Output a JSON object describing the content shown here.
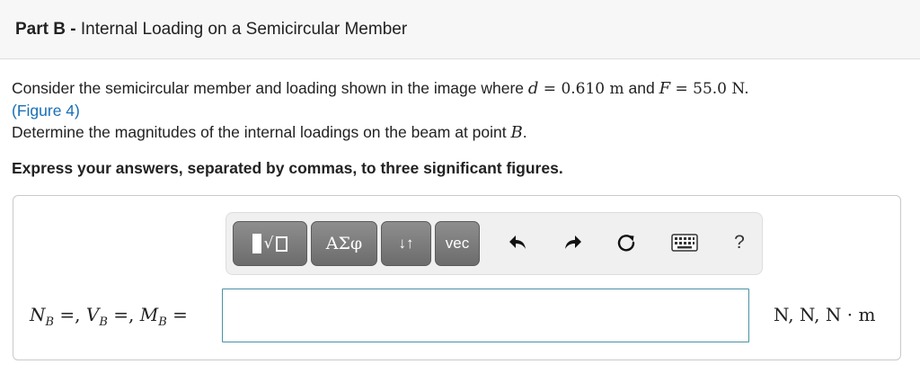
{
  "header": {
    "part_label": "Part B",
    "separator": " - ",
    "title": "Internal Loading on a Semicircular Member"
  },
  "problem": {
    "intro": "Consider the semicircular member and loading shown in the image where ",
    "d_symbol": "d",
    "d_value": " = 0.610 m",
    "and": " and ",
    "f_symbol": "F",
    "f_value": " = 55.0 N.",
    "figure_link": "(Figure 4)",
    "determine": "Determine the magnitudes of the internal loadings on the beam at point ",
    "point_symbol": "B",
    "period": "."
  },
  "instruction": "Express your answers, separated by commas, to three significant figures.",
  "toolbar": {
    "templates_icon": "templates-sqrt-icon",
    "templates_sqrt": "√",
    "greek_label": "ΑΣφ",
    "arrows_label": "↓↑",
    "vec_label": "vec",
    "undo_icon": "undo-icon",
    "redo_icon": "redo-icon",
    "reset_icon": "reset-icon",
    "keyboard_icon": "keyboard-icon",
    "help_label": "?"
  },
  "answer": {
    "n_symbol": "N",
    "v_symbol": "V",
    "m_symbol": "M",
    "subscript": "B",
    "eq": " =, ",
    "eq_last": " =",
    "value": "",
    "units": "N, N, N · m"
  },
  "colors": {
    "link": "#1a6fb5",
    "input_border": "#4a90a4",
    "toolbar_button": "#7a7a7a"
  }
}
